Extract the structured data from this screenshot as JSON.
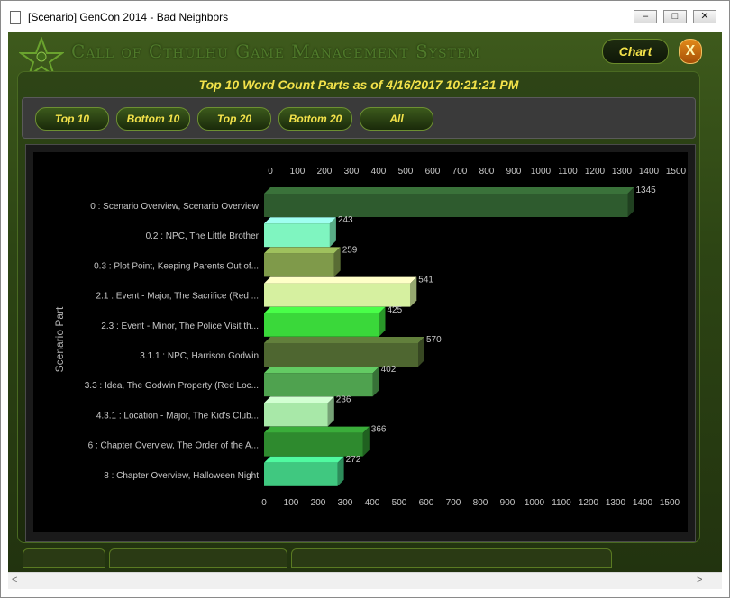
{
  "window": {
    "title": "[Scenario] GenCon 2014 - Bad Neighbors",
    "minimize": "–",
    "maximize": "□",
    "close": "✕"
  },
  "app": {
    "name": "Call of Cthulhu Game Management System",
    "chart_button": "Chart",
    "close_button": "X"
  },
  "filters": [
    "Top 10",
    "Bottom 10",
    "Top 20",
    "Bottom 20",
    "All"
  ],
  "colors": {
    "accent_yellow": "#f3e24a",
    "panel_green": "#2e4516"
  },
  "scroll": {
    "left": "<",
    "right": ">"
  },
  "chart_data": {
    "type": "bar",
    "orientation": "horizontal",
    "title": "Top 10 Word Count Parts as of 4/16/2017 10:21:21 PM",
    "ylabel": "Scenario Part",
    "xlim": [
      0,
      1500
    ],
    "xticks": [
      0,
      100,
      200,
      300,
      400,
      500,
      600,
      700,
      800,
      900,
      1000,
      1100,
      1200,
      1300,
      1400,
      1500
    ],
    "categories": [
      "0 : Scenario Overview, Scenario Overview",
      "0.2 : NPC, The Little Brother",
      "0.3 : Plot Point, Keeping Parents Out of...",
      "2.1 : Event - Major, The Sacrifice (Red ...",
      "2.3 : Event - Minor, The Police Visit th...",
      "3.1.1 : NPC, Harrison Godwin",
      "3.3 : Idea, The Godwin Property (Red Loc...",
      "4.3.1 : Location - Major, The Kid's Club...",
      "6 : Chapter Overview, The Order of the A...",
      "8 : Chapter Overview, Halloween Night"
    ],
    "values": [
      1345,
      243,
      259,
      541,
      425,
      570,
      402,
      236,
      366,
      272
    ],
    "bar_colors": [
      "#2e5b2e",
      "#7ff5c0",
      "#7f9a4a",
      "#d6f0a0",
      "#3ad83a",
      "#4e6630",
      "#4fa24f",
      "#a8e8a8",
      "#2e8a2e",
      "#40c880"
    ],
    "grid": false,
    "legend": "none"
  }
}
